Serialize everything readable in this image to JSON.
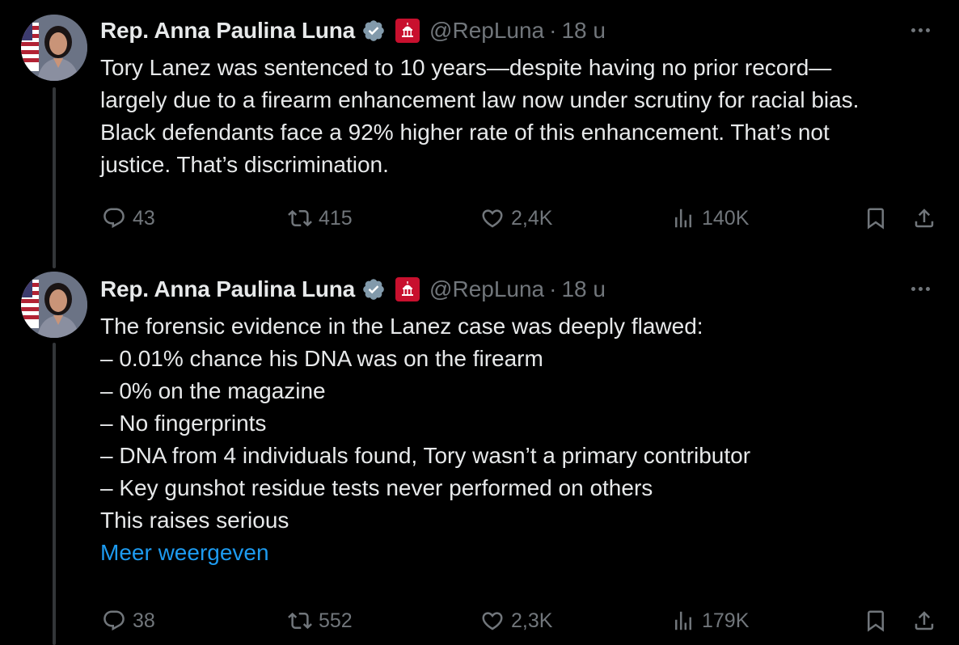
{
  "tweets": [
    {
      "author": {
        "name": "Rep. Anna Paulina Luna",
        "handle": "@RepLuna",
        "separator": "·",
        "time": "18 u"
      },
      "text_lines": [
        "Tory Lanez was sentenced to 10 years—despite having no prior record—",
        "largely due to a firearm enhancement law now under scrutiny for racial bias.",
        "Black defendants face a 92% higher rate of this enhancement. That’s not",
        "justice. That’s discrimination."
      ],
      "stats": {
        "replies": "43",
        "reposts": "415",
        "likes": "2,4K",
        "views": "140K"
      }
    },
    {
      "author": {
        "name": "Rep. Anna Paulina Luna",
        "handle": "@RepLuna",
        "separator": "·",
        "time": "18 u"
      },
      "text_lines": [
        "The forensic evidence in the Lanez case was deeply flawed:",
        "– 0.01% chance his DNA was on the firearm",
        "– 0% on the magazine",
        "– No fingerprints",
        "– DNA from 4 individuals found, Tory wasn’t a primary contributor",
        "– Key gunshot residue tests never performed on others",
        "This raises serious"
      ],
      "show_more": "Meer weergeven",
      "stats": {
        "replies": "38",
        "reposts": "552",
        "likes": "2,3K",
        "views": "179K"
      }
    }
  ],
  "colors": {
    "background": "#000000",
    "text": "#e7e9ea",
    "muted": "#71767b",
    "link": "#1d9bf0",
    "verified": "#829aab",
    "affiliation": "#c8102e"
  },
  "icons": [
    "reply-icon",
    "retweet-icon",
    "like-icon",
    "views-icon",
    "bookmark-icon",
    "share-icon",
    "verified-icon",
    "more-icon"
  ]
}
